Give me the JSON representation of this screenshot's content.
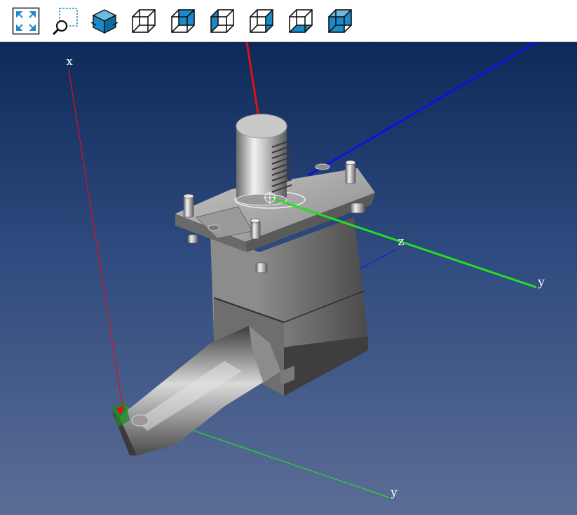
{
  "toolbar": {
    "buttons": [
      {
        "name": "fit-all",
        "icon": "fit-all-icon"
      },
      {
        "name": "zoom-window",
        "icon": "zoom-window-icon"
      },
      {
        "name": "view-iso",
        "icon": "isometric-cube-icon"
      },
      {
        "name": "view-front",
        "icon": "cube-front-icon"
      },
      {
        "name": "view-back",
        "icon": "cube-back-icon"
      },
      {
        "name": "view-left",
        "icon": "cube-left-icon"
      },
      {
        "name": "view-right",
        "icon": "cube-right-icon"
      },
      {
        "name": "view-bottom",
        "icon": "cube-bottom-icon"
      },
      {
        "name": "view-top",
        "icon": "cube-top-icon"
      }
    ]
  },
  "viewport": {
    "axis_labels": {
      "global_x": "x",
      "global_y": "y",
      "local_z": "z",
      "local_y": "y"
    },
    "colors": {
      "background_top": "#0e2a5a",
      "background_bottom": "#5b6d95",
      "x_axis": "#e01010",
      "y_axis": "#22e022",
      "z_axis": "#1010e0",
      "accent": "#1a8ac8"
    }
  }
}
